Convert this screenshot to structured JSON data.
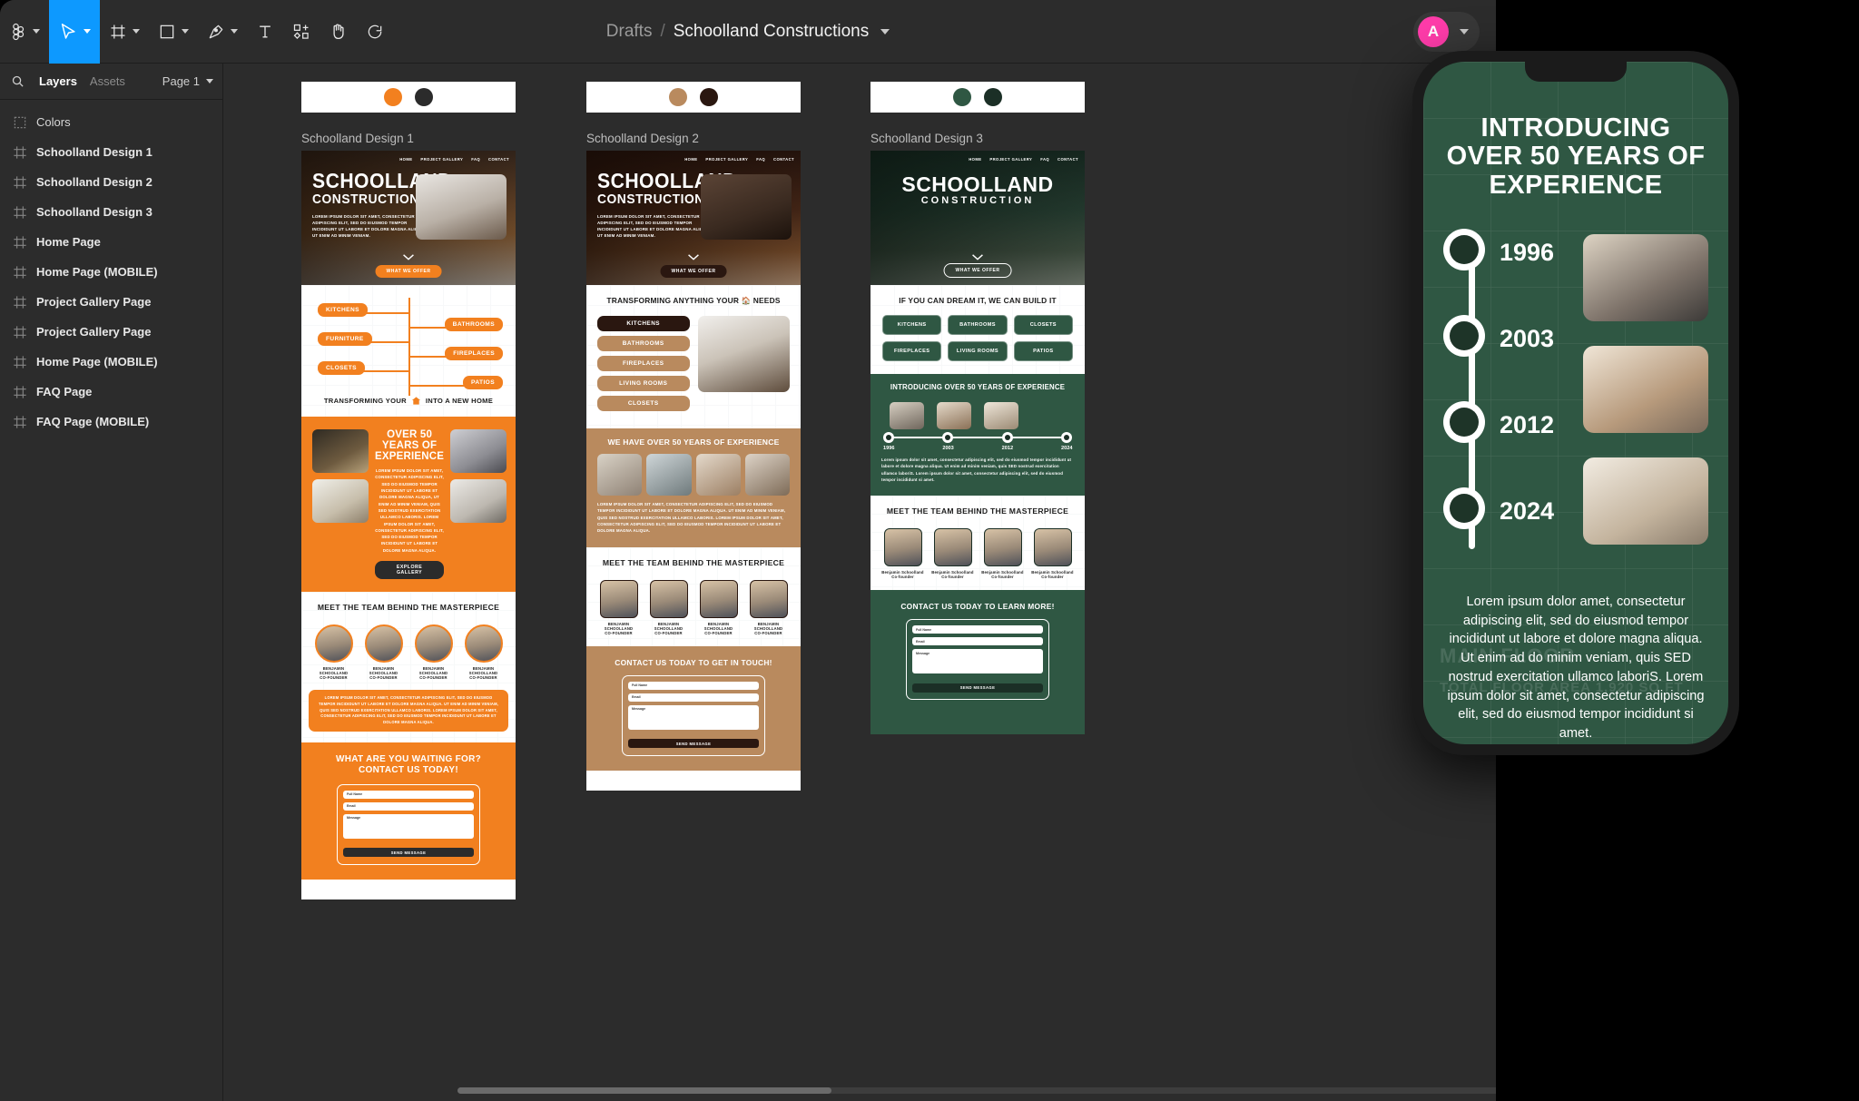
{
  "app": {
    "toolbar": {
      "tools": [
        {
          "name": "figma-menu",
          "icon": "figma-logo",
          "caret": true,
          "active": false
        },
        {
          "name": "move-tool",
          "icon": "cursor",
          "caret": true,
          "active": true
        },
        {
          "name": "frame-tool",
          "icon": "frame",
          "caret": true,
          "active": false
        },
        {
          "name": "shape-tool",
          "icon": "square",
          "caret": true,
          "active": false
        },
        {
          "name": "pen-tool",
          "icon": "pen",
          "caret": true,
          "active": false
        },
        {
          "name": "text-tool",
          "icon": "text-t",
          "caret": false,
          "active": false
        },
        {
          "name": "resources-tool",
          "icon": "components-plus",
          "caret": false,
          "active": false
        },
        {
          "name": "hand-tool",
          "icon": "hand",
          "caret": false,
          "active": false
        },
        {
          "name": "comment-tool",
          "icon": "comment-bubble",
          "caret": false,
          "active": false
        }
      ],
      "breadcrumb": {
        "root": "Drafts",
        "separator": "/",
        "file": "Schoolland Constructions"
      },
      "avatar": {
        "initial": "A",
        "color": "#ff3caa"
      }
    },
    "left_panel": {
      "tabs": [
        {
          "label": "Layers",
          "active": true
        },
        {
          "label": "Assets",
          "active": false
        }
      ],
      "page_selector": "Page 1",
      "search_icon": "search-icon",
      "layers": [
        {
          "name": "Colors",
          "type": "section"
        },
        {
          "name": "Schoolland Design 1",
          "type": "frame"
        },
        {
          "name": "Schoolland Design 2",
          "type": "frame"
        },
        {
          "name": "Schoolland Design 3",
          "type": "frame"
        },
        {
          "name": "Home Page",
          "type": "frame"
        },
        {
          "name": "Home Page (MOBILE)",
          "type": "frame"
        },
        {
          "name": "Project Gallery Page",
          "type": "frame"
        },
        {
          "name": "Project Gallery Page",
          "type": "frame"
        },
        {
          "name": "Home Page (MOBILE)",
          "type": "frame"
        },
        {
          "name": "FAQ Page",
          "type": "frame"
        },
        {
          "name": "FAQ Page (MOBILE)",
          "type": "frame"
        }
      ]
    },
    "canvas": {
      "artboards": [
        {
          "label": "Schoolland Design 1",
          "swatches": [
            "#f2801f",
            "#2b2b2b"
          ],
          "theme": {
            "accent": "#f2801f",
            "dark": "#2b2b2b"
          },
          "nav": [
            "HOME",
            "PROJECT GALLERY",
            "FAQ",
            "CONTACT"
          ],
          "brand_line1": "SCHOOLLAND",
          "brand_line2": "CONSTRUCTION",
          "hero_sub": "LOREM IPSUM DOLOR SIT AMET, CONSECTETUR ADIPISCING ELIT, SED DO EIUSMOD TEMPOR INCIDIDUNT UT LABORE ET DOLORE MAGNA ALIQUA, UT ENIM AD MINIM VENIAM.",
          "hero_cta": "WHAT WE OFFER",
          "offers_left": [
            "KITCHENS",
            "FURNITURE",
            "CLOSETS"
          ],
          "offers_right": [
            "BATHROOMS",
            "FIREPLACES",
            "PATIOS"
          ],
          "offers_tagline_before": "TRANSFORMING YOUR",
          "offers_tagline_after": "INTO A NEW HOME",
          "exp_heading": "OVER 50 YEARS OF EXPERIENCE",
          "exp_body": "LOREM IPSUM DOLOR SIT AMET, CONSECTETUR ADIPISCING ELIT, SED DO EIUSMOD TEMPOR INCIDIDUNT UT LABORE ET DOLORE MAGNA ALIQUA, UT ENIM AD MINIM VENIAM, QUIS SED NOSTRUD EXERCITATION ULLAMCO LABORIS. LOREM IPSUM DOLOR SIT AMET, CONSECTETUR ADIPISCING ELIT, SED DO EIUSMOD TEMPOR INCIDIDUNT UT LABORE ET DOLORE MAGNA ALIQUA.",
          "exp_btn": "EXPLORE GALLERY",
          "team_heading": "MEET THE TEAM BEHIND THE MASTERPIECE",
          "team": [
            {
              "name": "BENJAMIN SCHOOLLAND",
              "role": "CO-FOUNDER"
            },
            {
              "name": "BENJAMIN SCHOOLLAND",
              "role": "CO-FOUNDER"
            },
            {
              "name": "BENJAMIN SCHOOLLAND",
              "role": "CO-FOUNDER"
            },
            {
              "name": "BENJAMIN SCHOOLLAND",
              "role": "CO-FOUNDER"
            }
          ],
          "team_note": "LOREM IPSUM DOLOR SIT AMET, CONSECTETUR ADIPISCING ELIT, SED DO EIUSMOD TEMPOR INCIDIDUNT UT LABORE ET DOLORE MAGNA ALIQUA. UT ENIM AD MINIM VENIAM, QUIS SED NOSTRUD EXERCITATION ULLAMCO LABORIS. LOREM IPSUM DOLOR SIT AMET, CONSECTETUR ADIPISCING ELIT, SED DO EIUSMOD TEMPOR INCIDIDUNT UT LABORE ET DOLORE MAGNA ALIQUA.",
          "contact_heading_1": "WHAT ARE YOU WAITING FOR?",
          "contact_heading_2": "CONTACT US TODAY!",
          "form": {
            "name": "Full Name",
            "email": "Email",
            "message": "Message",
            "submit": "SEND MESSAGE"
          }
        },
        {
          "label": "Schoolland Design 2",
          "swatches": [
            "#b98a5e",
            "#2a1710"
          ],
          "theme": {
            "accent": "#b98a5e",
            "dark": "#2a1710"
          },
          "nav": [
            "HOME",
            "PROJECT GALLERY",
            "FAQ",
            "CONTACT"
          ],
          "brand_line1": "SCHOOLLAND",
          "brand_line2": "CONSTRUCTION",
          "hero_sub": "LOREM IPSUM DOLOR SIT AMET, CONSECTETUR ADIPISCING ELIT, SED DO EIUSMOD TEMPOR INCIDIDUNT UT LABORE ET DOLORE MAGNA ALIQUA, UT ENIM AD MINIM VENIAM.",
          "hero_cta": "WHAT WE OFFER",
          "offers_heading": "TRANSFORMING ANYTHING YOUR 🏠 NEEDS",
          "offers_list": [
            "KITCHENS",
            "BATHROOMS",
            "FIREPLACES",
            "LIVING ROOMS",
            "CLOSETS"
          ],
          "exp_heading": "WE HAVE OVER 50 YEARS OF EXPERIENCE",
          "exp_body": "LOREM IPSUM DOLOR SIT AMET, CONSECTETUR ADIPISCING ELIT, SED DO EIUSMOD TEMPOR INCIDIDUNT UT LABORE ET DOLORE MAGNA ALIQUA. UT ENIM AD MINIM VENIAM, QUIS SED NOSTRUD EXERCITATION ULLAMCO LABORIS. LOREM IPSUM DOLOR SIT AMET, CONSECTETUR ADIPISCING ELIT, SED DO EIUSMOD TEMPOR INCIDIDUNT UT LABORE ET DOLORE MAGNA ALIQUA.",
          "team_heading": "MEET THE TEAM BEHIND THE MASTERPIECE",
          "team": [
            {
              "name": "BENJAMIN SCHOOLLAND",
              "role": "CO-FOUNDER"
            },
            {
              "name": "BENJAMIN SCHOOLLAND",
              "role": "CO-FOUNDER"
            },
            {
              "name": "BENJAMIN SCHOOLLAND",
              "role": "CO-FOUNDER"
            },
            {
              "name": "BENJAMIN SCHOOLLAND",
              "role": "CO-FOUNDER"
            }
          ],
          "contact_heading_1": "CONTACT US TODAY TO GET IN TOUCH!",
          "form": {
            "name": "Full Name",
            "email": "Email",
            "message": "Message",
            "submit": "SEND MESSAGE"
          }
        },
        {
          "label": "Schoolland Design 3",
          "swatches": [
            "#2f5743",
            "#1b2f26"
          ],
          "theme": {
            "accent": "#2f5743",
            "dark": "#1b2f26"
          },
          "nav": [
            "HOME",
            "PROJECT GALLERY",
            "FAQ",
            "CONTACT"
          ],
          "brand_line1": "SCHOOLLAND",
          "brand_line2": "CONSTRUCTION",
          "hero_sub": "LOREM IPSUM DOLOR SIT AMET, CONSECTETUR ADIPISCING ELIT, SED DO EIUSMOD TEMPOR INCIDIDUNT UT LABORE ET DOLORE MAGNA ALIQUA, UT ENIM AD MINIM VENIAM.",
          "hero_cta": "WHAT WE OFFER",
          "offers_heading": "IF YOU CAN DREAM IT, WE CAN BUILD IT",
          "offers_list": [
            "KITCHENS",
            "BATHROOMS",
            "CLOSETS",
            "FIREPLACES",
            "LIVING ROOMS",
            "PATIOS"
          ],
          "exp_heading": "INTRODUCING OVER 50 YEARS OF EXPERIENCE",
          "timeline_years": [
            "1996",
            "2003",
            "2012",
            "2024"
          ],
          "exp_body": "Lorem ipsum dolor sit amet, consectetur adipiscing elit, sed do eiusmod tempor incididunt ut labore et dolore magna aliqua. Ut enim ad minim veniam, quis SED nostrud exercitation ullamco laboriS. Lorem ipsum dolor sit amet, consectetur adipiscing elit, sed do eiusmod tempor incididunt si amet.",
          "team_heading": "MEET THE TEAM BEHIND THE MASTERPIECE",
          "team": [
            {
              "name": "Benjamin Schoolland",
              "role": "Co-founder"
            },
            {
              "name": "Benjamin Schoolland",
              "role": "Co-founder"
            },
            {
              "name": "Benjamin Schoolland",
              "role": "Co-founder"
            },
            {
              "name": "Benjamin Schoolland",
              "role": "Co-founder"
            }
          ],
          "contact_heading_1": "CONTACT US TODAY TO LEARN MORE!",
          "form": {
            "name": "Full Name",
            "email": "Email",
            "message": "Message",
            "submit": "SEND MESSAGE"
          }
        }
      ]
    },
    "phone_mockup": {
      "heading": "INTRODUCING OVER 50 YEARS OF EXPERIENCE",
      "timeline": [
        {
          "year": "1996"
        },
        {
          "year": "2003"
        },
        {
          "year": "2012"
        },
        {
          "year": "2024"
        }
      ],
      "body": "Lorem ipsum dolor amet, consectetur adipiscing elit, sed do eiusmod tempor incididunt ut labore et dolore magna aliqua. Ut enim ad do minim veniam, quis SED nostrud exercitation ullamco laboriS. Lorem ipsum dolor sit amet, consectetur adipiscing elit, sed do eiusmod tempor incididunt si amet.",
      "ghost_text_1": "MAIN FLOOR",
      "ghost_text_2": "TOTAL FLOOR AREA   1,920 SQ FT",
      "bg_color": "#2f5743"
    }
  }
}
